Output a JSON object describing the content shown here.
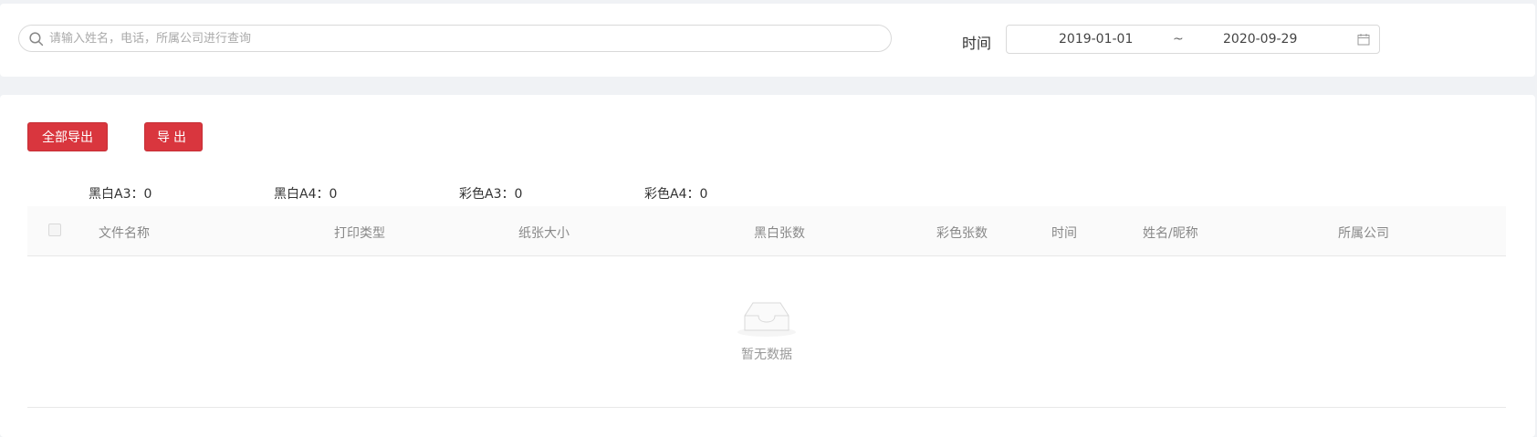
{
  "search": {
    "placeholder": "请输入姓名，电话，所属公司进行查询"
  },
  "filter": {
    "time_label": "时间",
    "date_start": "2019-01-01",
    "date_separator": "~",
    "date_end": "2020-09-29"
  },
  "actions": {
    "export_all": "全部导出",
    "export": "导出"
  },
  "stats": [
    {
      "label": "黑白A3：0"
    },
    {
      "label": "黑白A4：0"
    },
    {
      "label": "彩色A3：0"
    },
    {
      "label": "彩色A4：0"
    }
  ],
  "table": {
    "columns": [
      "文件名称",
      "打印类型",
      "纸张大小",
      "黑白张数",
      "彩色张数",
      "时间",
      "姓名/昵称",
      "所属公司"
    ],
    "rows": [],
    "empty_text": "暂无数据"
  },
  "colors": {
    "accent": "#d9363e",
    "background": "#f0f2f5"
  }
}
